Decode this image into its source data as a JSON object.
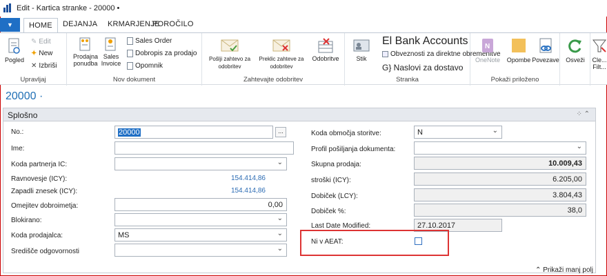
{
  "window": {
    "title": "Edit - Kartica stranke - 20000 •"
  },
  "tabs": {
    "home": "HOME",
    "dejanja": "DEJANJA",
    "kmarjenje": "KRMARJENJE",
    "porocilo": "POROČILO"
  },
  "ribbon": {
    "upravljaj": {
      "label": "Upravljaj",
      "pogled": "Pogled",
      "edit": "Edit",
      "new": "New",
      "izbrisi": "Izbriši"
    },
    "nov_dokument": {
      "label": "Nov dokument",
      "prodajna_ponudba": "Prodajna ponudba",
      "sales_invoice": "Sales Invoice",
      "sales_order": "Sales Order",
      "dobropis": "Dobropis za prodajo",
      "opomnik": "Opomnik"
    },
    "zahtevajte_odobritev": {
      "label": "Zahtevajte odobritev",
      "poslji": "Pošlji zahtevo za odobritev",
      "preklic": "Preklic zahteve za odobritev",
      "odobritve": "Odobritve"
    },
    "stranka": {
      "label": "Stranka",
      "stik": "Stik",
      "bank_accounts": "El Bank Accounts",
      "obveznosti": "Obveznosti za direktne obremenitve",
      "naslovi": "G} Naslovi za dostavo"
    },
    "pokazi_prilozeno": {
      "label": "Pokaži priloženo",
      "onenote": "OneNote",
      "opombe": "Opombe",
      "povezave": "Povezave"
    },
    "osvezi": "Osveži",
    "clear_filter": "Cle... Filt..."
  },
  "page": {
    "number": "20000 ·"
  },
  "fasttab": {
    "title": "Splošno",
    "left": {
      "no_label": "No.:",
      "no_value": "20000",
      "ime_label": "Ime:",
      "ime_value": "",
      "koda_partnerja_label": "Koda partnerja IC:",
      "ravnovesje_label": "Ravnovesje (ICY):",
      "ravnovesje_value": "154.414,86",
      "zapadli_label": "Zapadli znesek (ICY):",
      "zapadli_value": "154.414,86",
      "omejitev_label": "Omejitev dobroimetja:",
      "omejitev_value": "0,00",
      "blokirano_label": "Blokirano:",
      "koda_prodajalca_label": "Koda prodajalca:",
      "koda_prodajalca_value": "MS",
      "sredisce_label": "Središče odgovornosti"
    },
    "right": {
      "koda_obmocja_label": "Koda območja storitve:",
      "koda_obmocja_value": "N",
      "profil_label": "Profil pošiljanja dokumenta:",
      "skupna_prodaja_label": "Skupna prodaja:",
      "skupna_prodaja_value": "10.009,43",
      "stroski_label": "stroški (ICY):",
      "stroski_value": "6.205,00",
      "dobicek_label": "Dobiček (LCY):",
      "dobicek_value": "3.804,43",
      "dobicek_pct_label": "Dobiček %:",
      "dobicek_pct_value": "38,0",
      "last_modified_label": "Last Date Modified:",
      "last_modified_value": "27.10.2017",
      "ni_v_aeat_label": "Ni v AEAT:"
    },
    "show_less": "Prikaži manj polj"
  },
  "colors": {
    "accent": "#1f6fc5",
    "highlight_box": "#d33333"
  }
}
